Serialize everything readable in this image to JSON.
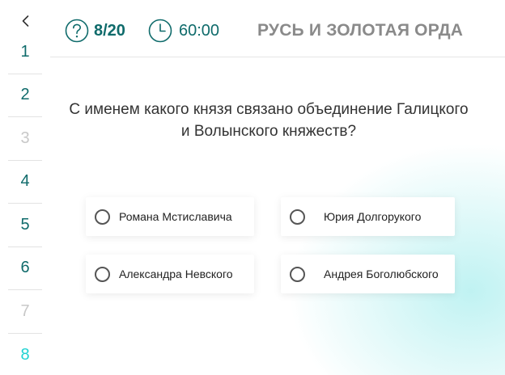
{
  "sidebar": {
    "back_icon": "chevron-left-icon",
    "items": [
      {
        "label": "1",
        "state": "done"
      },
      {
        "label": "2",
        "state": "done"
      },
      {
        "label": "3",
        "state": "pending"
      },
      {
        "label": "4",
        "state": "done"
      },
      {
        "label": "5",
        "state": "done"
      },
      {
        "label": "6",
        "state": "done"
      },
      {
        "label": "7",
        "state": "pending"
      },
      {
        "label": "8",
        "state": "current"
      }
    ]
  },
  "header": {
    "counter": "8/20",
    "counter_icon": "question-circle-icon",
    "timer": "60:00",
    "timer_icon": "clock-icon",
    "topic": "РУСЬ И ЗОЛОТАЯ ОРДА"
  },
  "question": {
    "text": "С именем какого князя связано объединение Галицкого и Волынского княжеств?"
  },
  "options": [
    {
      "label": "Романа Мстиславича",
      "selected": false
    },
    {
      "label": "Юрия Долгорукого",
      "selected": false
    },
    {
      "label": "Александра Невского",
      "selected": false
    },
    {
      "label": "Андрея Боголюбского",
      "selected": false
    }
  ],
  "colors": {
    "accent": "#0f6b6b",
    "current": "#20d2d2",
    "pending": "#c8c8c8",
    "topic": "#8a8a8a"
  }
}
